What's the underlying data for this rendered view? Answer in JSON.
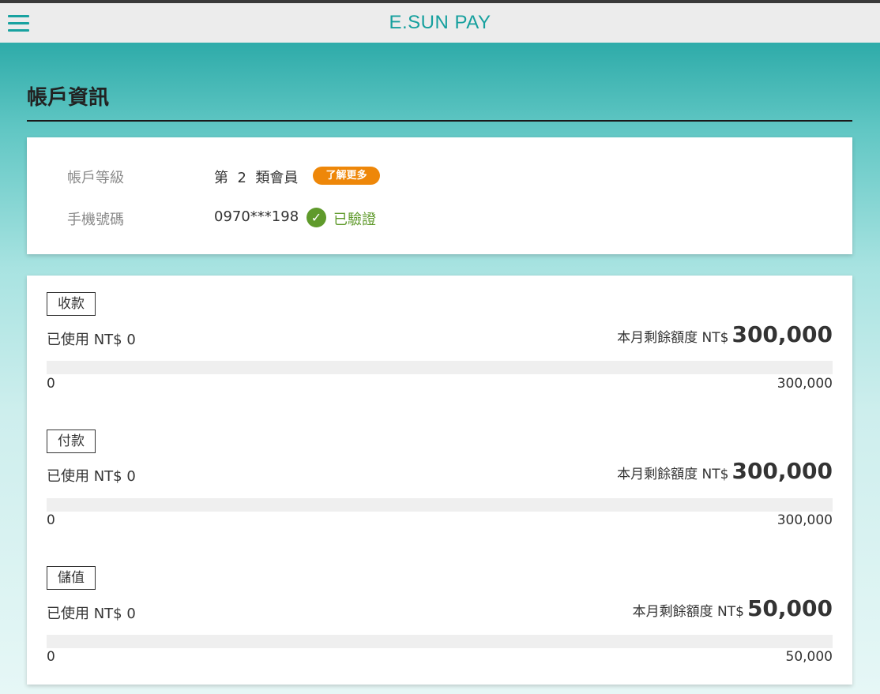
{
  "header": {
    "brand": "E.SUN PAY",
    "menu_icon": "hamburger-menu-icon"
  },
  "page": {
    "title": "帳戶資訊"
  },
  "account": {
    "level_label": "帳戶等級",
    "level_value": "第  2  類會員",
    "learn_more": "了解更多",
    "phone_label": "手機號碼",
    "phone_value": "0970***198",
    "verified_icon": "check-circle-icon",
    "verified_label": "已驗證"
  },
  "limits": [
    {
      "tag": "收款",
      "used": "已使用 NT$ 0",
      "remaining_label": "本月剩餘額度 NT$",
      "remaining_amount": "300,000",
      "used_fraction": 0,
      "min": "0",
      "max": "300,000"
    },
    {
      "tag": "付款",
      "used": "已使用 NT$ 0",
      "remaining_label": "本月剩餘額度 NT$",
      "remaining_amount": "300,000",
      "used_fraction": 0,
      "min": "0",
      "max": "300,000"
    },
    {
      "tag": "儲值",
      "used": "已使用 NT$ 0",
      "remaining_label": "本月剩餘額度 NT$",
      "remaining_amount": "50,000",
      "used_fraction": 0,
      "min": "0",
      "max": "50,000"
    }
  ],
  "colors": {
    "brand": "#16a09e",
    "badge": "#ee8709",
    "verified": "#5f9a2b"
  }
}
